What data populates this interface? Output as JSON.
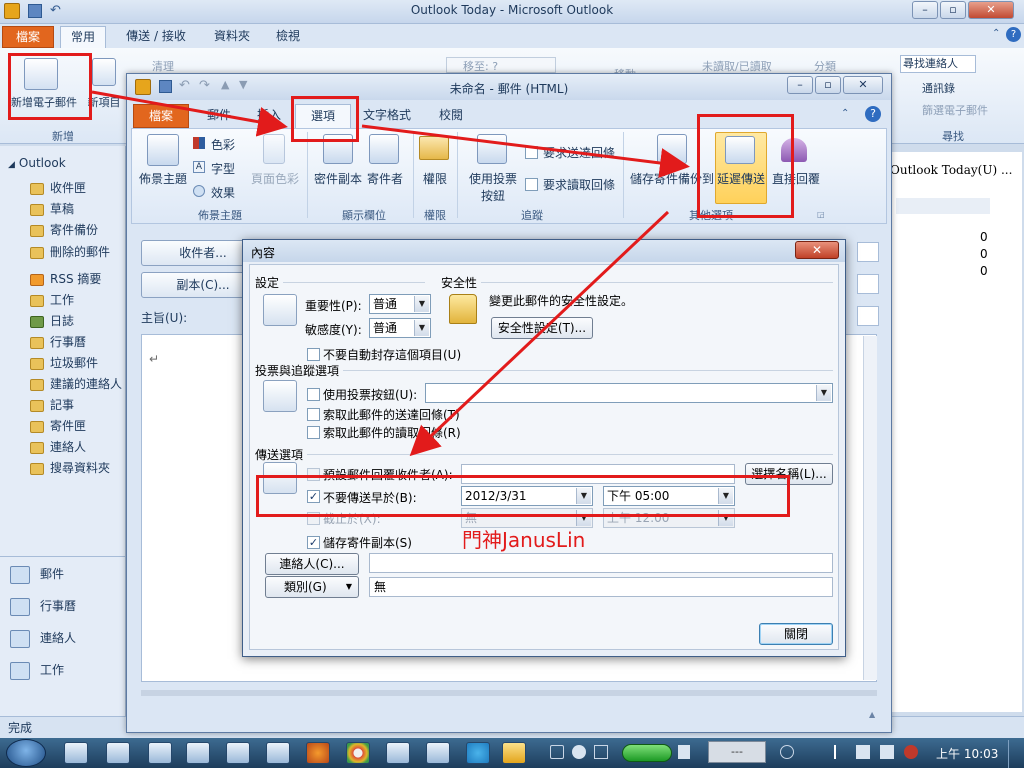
{
  "main_window": {
    "title": "Outlook Today - Microsoft Outlook",
    "tabs": [
      "檔案",
      "常用",
      "傳送 / 接收",
      "資料夾",
      "檢視"
    ],
    "ribbon": {
      "new_email": "新增電子郵件",
      "new_items": "新項目",
      "new_group": "新增",
      "clean_up": "清理",
      "move_to": "移至: ?",
      "move": "移動",
      "unread_read": "未讀取/已讀取",
      "categorize": "分類",
      "follow_up": "待處理",
      "find_contact": "尋找連絡人",
      "address_book": "通訊錄",
      "filter_email": "篩選電子郵件",
      "find_group": "尋找"
    },
    "nav": {
      "root": "Outlook",
      "folders": [
        "收件匣",
        "草稿",
        "寄件備份",
        "刪除的郵件",
        "RSS 摘要",
        "工作",
        "日誌",
        "行事曆",
        "垃圾郵件",
        "建議的連絡人",
        "記事",
        "寄件匣",
        "連絡人",
        "搜尋資料夾"
      ],
      "big_buttons": [
        "郵件",
        "行事曆",
        "連絡人",
        "工作"
      ]
    },
    "right_panel": {
      "outlook_today": "Outlook Today(U) ...",
      "counts": [
        "0",
        "0",
        "0"
      ]
    },
    "status": "完成"
  },
  "compose_window": {
    "title": "未命名 - 郵件 (HTML)",
    "tabs": [
      "檔案",
      "郵件",
      "插入",
      "選項",
      "文字格式",
      "校閱"
    ],
    "ribbon": {
      "theme": "佈景主題",
      "colors": "色彩",
      "fonts": "字型",
      "effects": "效果",
      "page_color": "頁面色彩",
      "theme_group": "佈景主題",
      "bcc": "密件副本",
      "from": "寄件者",
      "show_fields_group": "顯示欄位",
      "permission": "權限",
      "permission_group": "權限",
      "use_voting": "使用投票按鈕",
      "request_delivery": "要求送達回條",
      "request_read": "要求讀取回條",
      "tracking_group": "追蹤",
      "save_sent": "儲存寄件備份到",
      "delay_delivery": "延遲傳送",
      "direct_replies": "直接回覆",
      "more_options_group": "其他選項"
    },
    "to_button": "收件者...",
    "cc_button": "副本(C)...",
    "subject_label": "主旨(U):",
    "body_mark": "↵"
  },
  "dialog": {
    "title": "內容",
    "close_glyph": "✕",
    "settings": {
      "title": "設定",
      "importance_label": "重要性(P):",
      "importance_value": "普通",
      "sensitivity_label": "敏感度(Y):",
      "sensitivity_value": "普通",
      "no_autoarchive": "不要自動封存這個項目(U)"
    },
    "security": {
      "title": "安全性",
      "text": "變更此郵件的安全性設定。",
      "button": "安全性設定(T)..."
    },
    "voting": {
      "title": "投票與追蹤選項",
      "use_voting": "使用投票按鈕(U):",
      "delivery_receipt": "索取此郵件的送達回條(T)",
      "read_receipt": "索取此郵件的讀取回條(R)"
    },
    "delivery": {
      "title": "傳送選項",
      "reply_to": "預設郵件回覆收件者(A):",
      "select_names": "選擇名稱(L)...",
      "do_not_deliver": "不要傳送早於(B):",
      "deliver_date": "2012/3/31",
      "deliver_time": "下午 05:00",
      "expires": "截止於(X):",
      "expires_date": "無",
      "expires_time": "上午 12:00",
      "save_copy": "儲存寄件副本(S)",
      "checked": "✓"
    },
    "contacts_button": "連絡人(C)...",
    "categories_button": "類別(G)",
    "categories_value": "無",
    "close_button": "關閉"
  },
  "taskbar": {
    "time": "上午 10:03",
    "hidden": "---"
  },
  "annotation": {
    "watermark": "門神JanusLin",
    "color": "#e21b1b"
  }
}
